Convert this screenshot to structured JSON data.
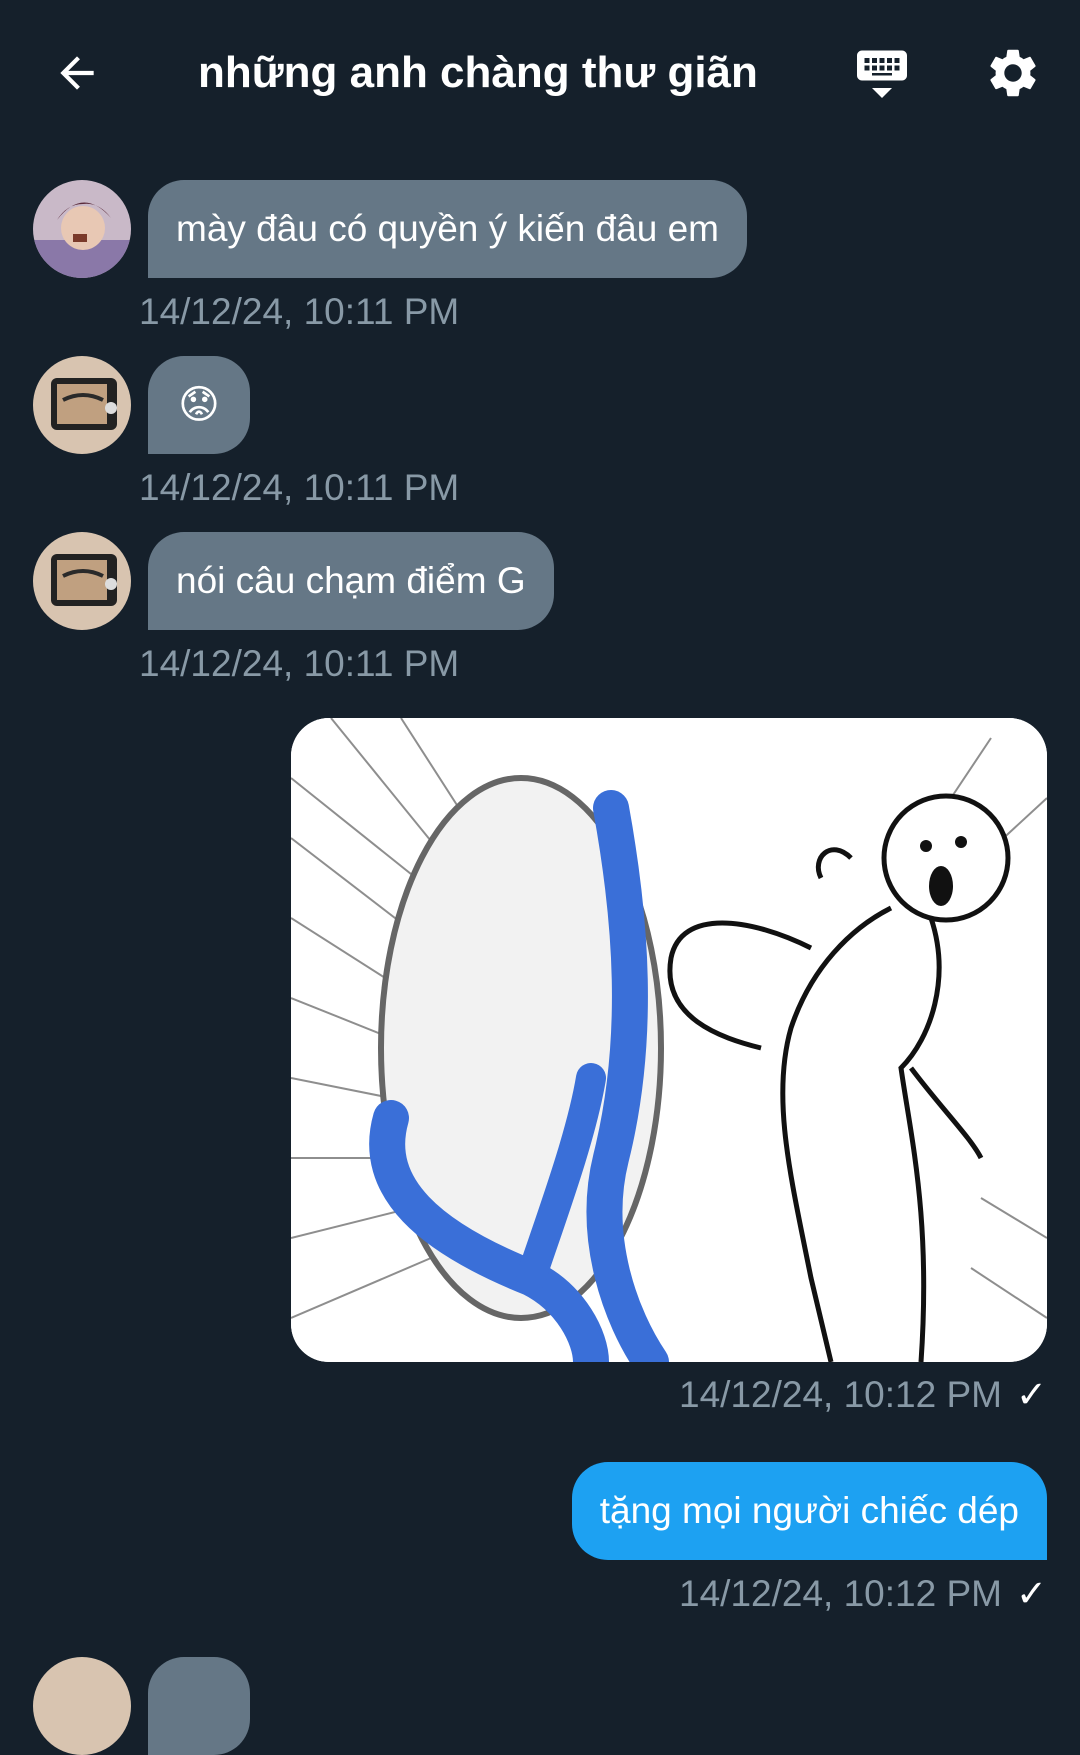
{
  "header": {
    "title": "những anh chàng thư giãn",
    "back_icon": "arrow-left-icon",
    "keyboard_icon": "keyboard-icon",
    "settings_icon": "gear-icon"
  },
  "messages": [
    {
      "direction": "in",
      "text": "mày đâu có quyền ý kiến đâu em",
      "timestamp": "14/12/24, 10:11 PM"
    },
    {
      "direction": "in",
      "text": "😟",
      "timestamp": "14/12/24, 10:11 PM"
    },
    {
      "direction": "in",
      "text": "nói câu chạm điểm G",
      "timestamp": "14/12/24, 10:11 PM"
    },
    {
      "direction": "out",
      "type": "image",
      "timestamp": "14/12/24, 10:12 PM",
      "status": "✓"
    },
    {
      "direction": "out",
      "text": "tặng mọi người chiếc dép",
      "timestamp": "14/12/24, 10:12 PM",
      "status": "✓"
    }
  ],
  "colors": {
    "background": "#15202b",
    "incoming_bubble": "#657786",
    "outgoing_bubble": "#1da1f2",
    "timestamp": "#8899a6"
  }
}
